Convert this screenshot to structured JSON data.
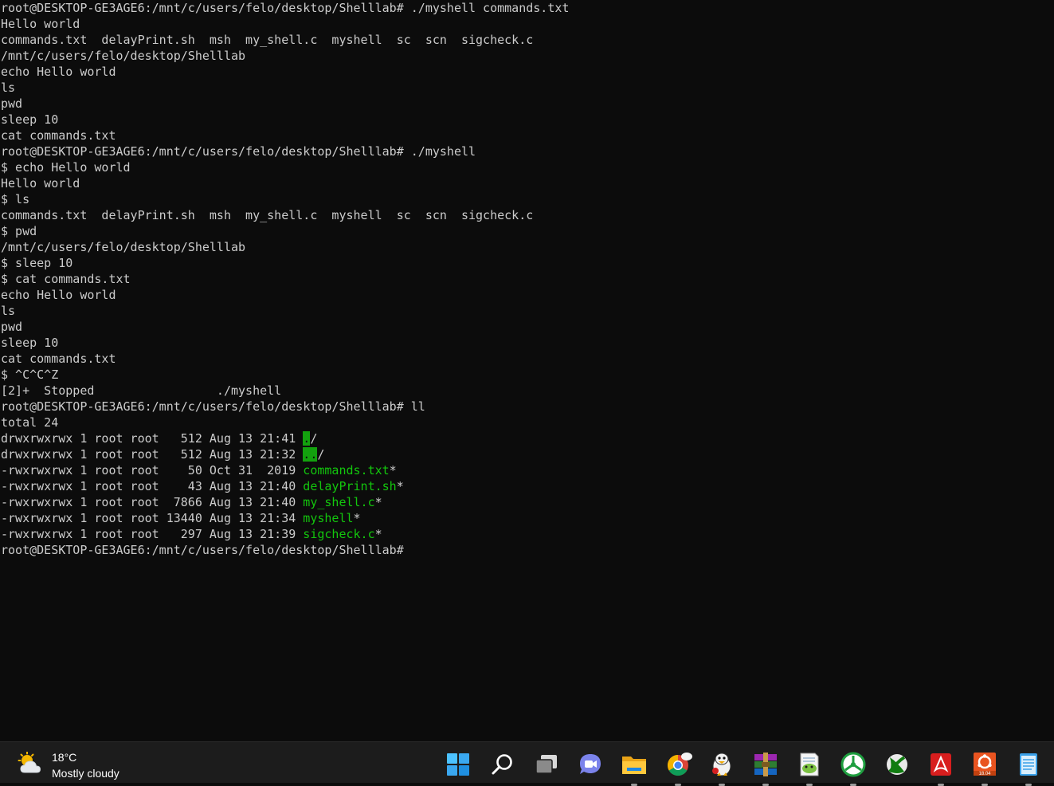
{
  "terminal": {
    "lines": [
      [
        {
          "t": "root@DESKTOP-GE3AGE6:/mnt/c/users/felo/desktop/Shelllab# ./myshell commands.txt"
        }
      ],
      [
        {
          "t": "Hello world"
        }
      ],
      [
        {
          "t": "commands.txt  delayPrint.sh  msh  my_shell.c  myshell  sc  scn  sigcheck.c"
        }
      ],
      [
        {
          "t": "/mnt/c/users/felo/desktop/Shelllab"
        }
      ],
      [
        {
          "t": "echo Hello world"
        }
      ],
      [
        {
          "t": "ls"
        }
      ],
      [
        {
          "t": "pwd"
        }
      ],
      [
        {
          "t": "sleep 10"
        }
      ],
      [
        {
          "t": "cat commands.txt"
        }
      ],
      [
        {
          "t": "root@DESKTOP-GE3AGE6:/mnt/c/users/felo/desktop/Shelllab# ./myshell"
        }
      ],
      [
        {
          "t": "$ echo Hello world"
        }
      ],
      [
        {
          "t": "Hello world"
        }
      ],
      [
        {
          "t": "$ ls"
        }
      ],
      [
        {
          "t": "commands.txt  delayPrint.sh  msh  my_shell.c  myshell  sc  scn  sigcheck.c"
        }
      ],
      [
        {
          "t": "$ pwd"
        }
      ],
      [
        {
          "t": "/mnt/c/users/felo/desktop/Shelllab"
        }
      ],
      [
        {
          "t": "$ sleep 10"
        }
      ],
      [
        {
          "t": "$ cat commands.txt"
        }
      ],
      [
        {
          "t": "echo Hello world"
        }
      ],
      [
        {
          "t": "ls"
        }
      ],
      [
        {
          "t": "pwd"
        }
      ],
      [
        {
          "t": "sleep 10"
        }
      ],
      [
        {
          "t": "cat commands.txt"
        }
      ],
      [
        {
          "t": "$ ^C^C^Z"
        }
      ],
      [
        {
          "t": "[2]+  Stopped                 ./myshell"
        }
      ],
      [
        {
          "t": "root@DESKTOP-GE3AGE6:/mnt/c/users/felo/desktop/Shelllab# ll"
        }
      ],
      [
        {
          "t": "total 24"
        }
      ],
      [
        {
          "t": "drwxrwxrwx 1 root root   512 Aug 13 21:41 "
        },
        {
          "t": ".",
          "c": "hl"
        },
        {
          "t": "/"
        }
      ],
      [
        {
          "t": "drwxrwxrwx 1 root root   512 Aug 13 21:32 "
        },
        {
          "t": "..",
          "c": "hl"
        },
        {
          "t": "/"
        }
      ],
      [
        {
          "t": "-rwxrwxrwx 1 root root    50 Oct 31  2019 "
        },
        {
          "t": "commands.txt",
          "c": "green"
        },
        {
          "t": "*"
        }
      ],
      [
        {
          "t": "-rwxrwxrwx 1 root root    43 Aug 13 21:40 "
        },
        {
          "t": "delayPrint.sh",
          "c": "green"
        },
        {
          "t": "*"
        }
      ],
      [
        {
          "t": "-rwxrwxrwx 1 root root  7866 Aug 13 21:40 "
        },
        {
          "t": "my_shell.c",
          "c": "green"
        },
        {
          "t": "*"
        }
      ],
      [
        {
          "t": "-rwxrwxrwx 1 root root 13440 Aug 13 21:34 "
        },
        {
          "t": "myshell",
          "c": "green"
        },
        {
          "t": "*"
        }
      ],
      [
        {
          "t": "-rwxrwxrwx 1 root root   297 Aug 13 21:39 "
        },
        {
          "t": "sigcheck.c",
          "c": "green"
        },
        {
          "t": "*"
        }
      ],
      [
        {
          "t": "root@DESKTOP-GE3AGE6:/mnt/c/users/felo/desktop/Shelllab# "
        }
      ]
    ],
    "colors": {
      "background": "#0c0c0c",
      "foreground": "#cccccc",
      "executable": "#13c60d",
      "directory_highlight": "#13a10e"
    }
  },
  "taskbar": {
    "weather": {
      "temperature": "18°C",
      "condition": "Mostly cloudy",
      "icon": "partly-cloudy-icon"
    },
    "apps": [
      {
        "icon": "windows-start-icon",
        "running": false
      },
      {
        "icon": "search-icon",
        "running": false
      },
      {
        "icon": "task-view-icon",
        "running": false
      },
      {
        "icon": "teams-chat-icon",
        "running": false
      },
      {
        "icon": "file-explorer-icon",
        "running": true
      },
      {
        "icon": "chrome-icon",
        "running": true
      },
      {
        "icon": "tux-penguin-icon",
        "running": true
      },
      {
        "icon": "winrar-icon",
        "running": true
      },
      {
        "icon": "notepad-plus-plus-icon",
        "running": true
      },
      {
        "icon": "green-circle-app-icon",
        "running": true
      },
      {
        "icon": "xbox-icon",
        "running": false
      },
      {
        "icon": "acrobat-reader-icon",
        "running": true
      },
      {
        "icon": "ubuntu-icon",
        "running": true,
        "badge": "18.04"
      },
      {
        "icon": "notepad-icon",
        "running": true
      }
    ]
  }
}
